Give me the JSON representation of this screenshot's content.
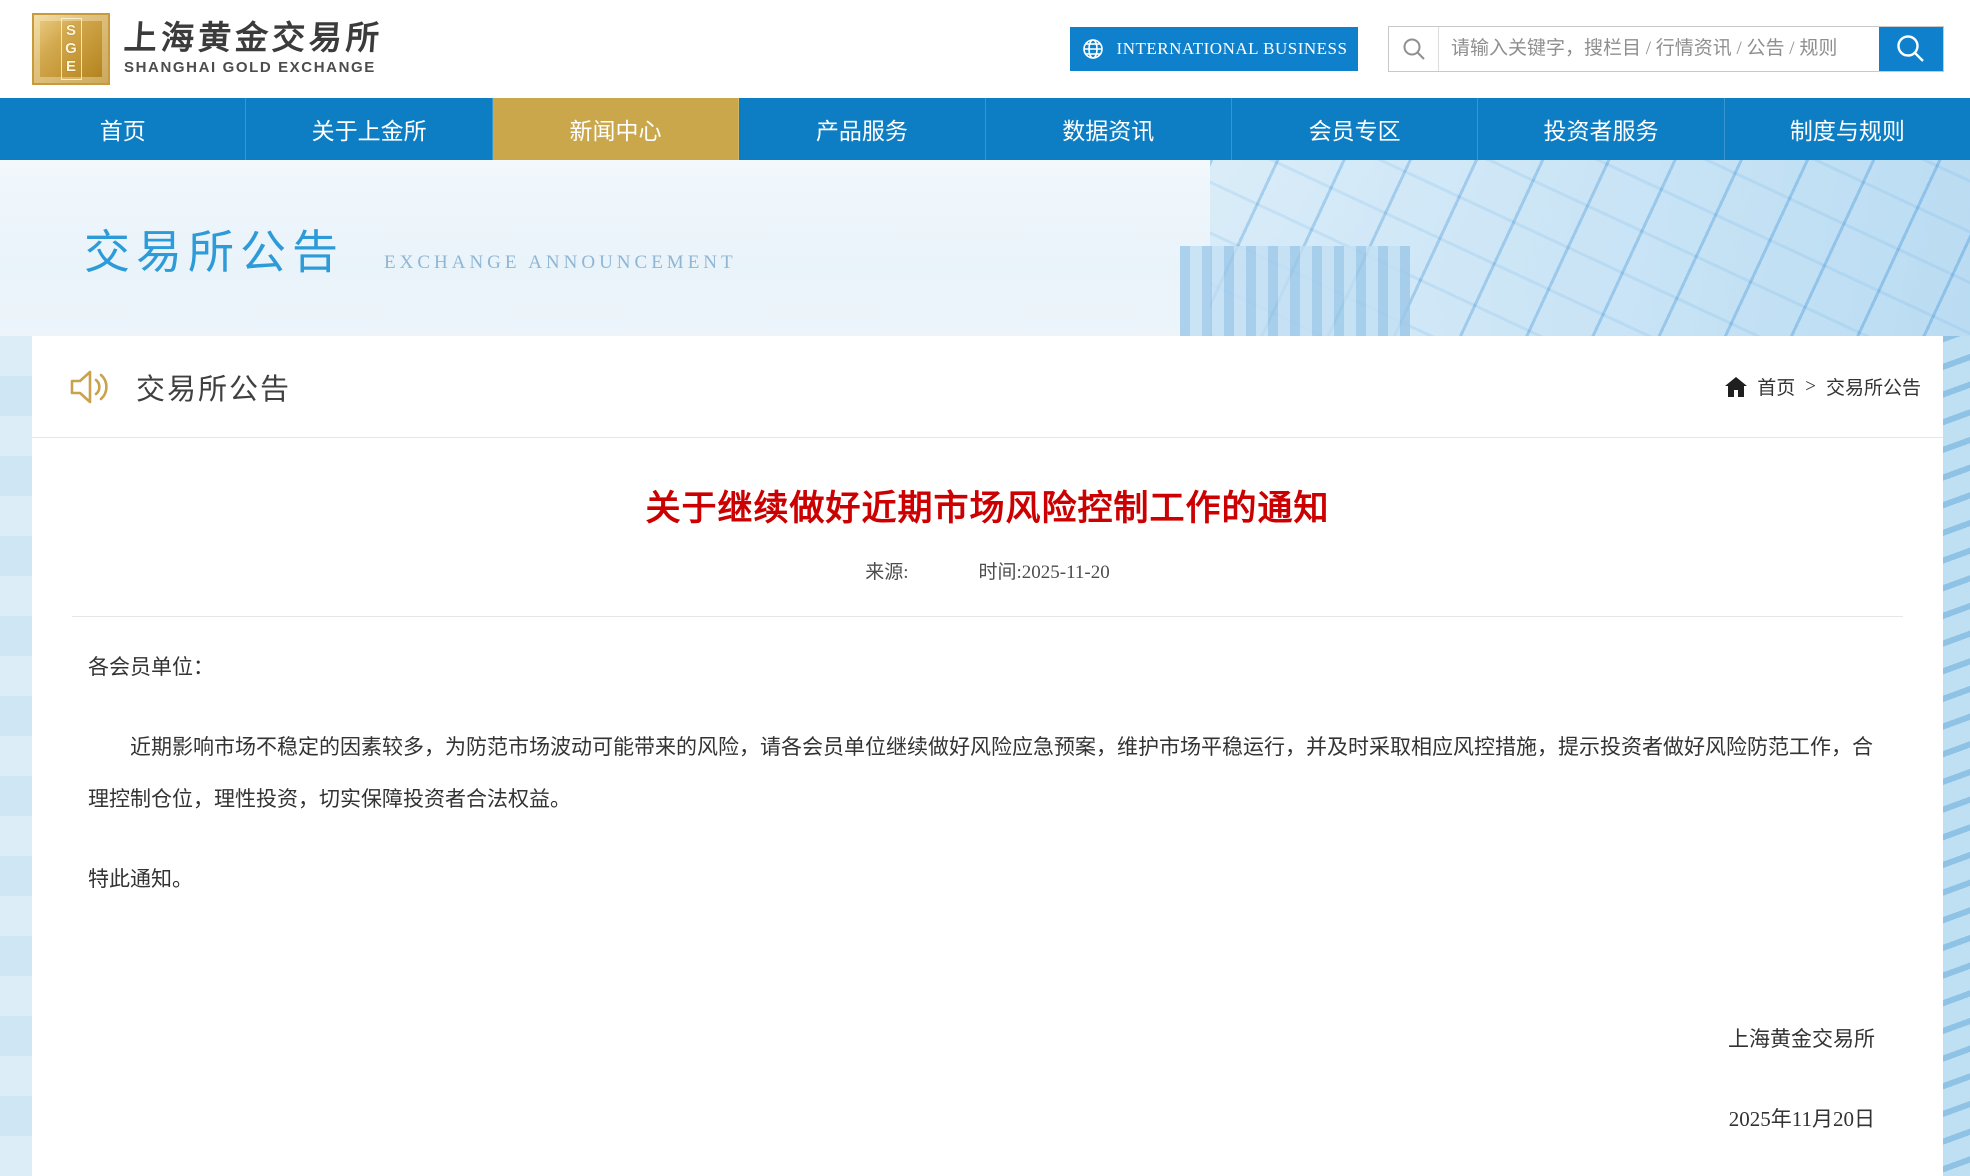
{
  "header": {
    "logo": {
      "abbr": "SGE",
      "title_cn": "上海黄金交易所",
      "title_en": "SHANGHAI GOLD EXCHANGE"
    },
    "intl_button_label": "INTERNATIONAL BUSINESS",
    "search": {
      "placeholder": "请输入关键字，搜栏目 / 行情资讯 / 公告 / 规则",
      "value": ""
    }
  },
  "nav": {
    "items": [
      {
        "label": "首页"
      },
      {
        "label": "关于上金所"
      },
      {
        "label": "新闻中心",
        "active": true
      },
      {
        "label": "产品服务"
      },
      {
        "label": "数据资讯"
      },
      {
        "label": "会员专区"
      },
      {
        "label": "投资者服务"
      },
      {
        "label": "制度与规则"
      }
    ]
  },
  "banner": {
    "title": "交易所公告",
    "subtitle": "EXCHANGE ANNOUNCEMENT"
  },
  "page": {
    "section_title": "交易所公告",
    "breadcrumb": {
      "home": "首页",
      "separator": ">",
      "current": "交易所公告"
    }
  },
  "article": {
    "title": "关于继续做好近期市场风险控制工作的通知",
    "source_label": "来源:",
    "time_label": "时间:2025-11-20",
    "paragraphs": [
      "各会员单位：",
      "近期影响市场不稳定的因素较多，为防范市场波动可能带来的风险，请各会员单位继续做好风险应急预案，维护市场平稳运行，并及时采取相应风控措施，提示投资者做好风险防范工作，合理控制仓位，理性投资，切实保障投资者合法权益。",
      "特此通知。"
    ],
    "signature": "上海黄金交易所",
    "date": "2025年11月20日"
  },
  "colors": {
    "nav_blue": "#0E7EC4",
    "active_gold": "#C9A74A",
    "button_blue": "#0F81CC",
    "banner_title_blue": "#2D9BD7",
    "banner_subtitle_blue": "#8FB6D4",
    "article_title_red": "#CC0000",
    "logo_gold": "#C79B3B",
    "speaker_icon_gold": "#C9A24B"
  }
}
